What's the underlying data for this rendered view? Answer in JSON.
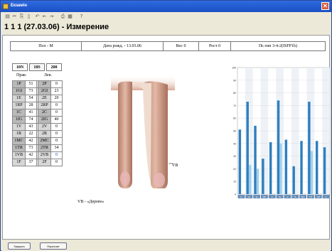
{
  "window": {
    "title": "Екзамін",
    "close_glyph": "✕",
    "heading": "1 1 1 (27.03.06) - Измерение"
  },
  "toolbar": [
    "open-icon",
    "cut-icon",
    "copy-icon",
    "paste-icon",
    "undo-icon",
    "left-arrow-icon",
    "right-arrow-icon",
    "print-icon",
    "chart-icon",
    "help-icon"
  ],
  "toolbar_glyphs": [
    "▤",
    "✂",
    "⎘",
    "▯",
    "↶",
    "←",
    "→",
    "⎙",
    "▦",
    "?"
  ],
  "patient": {
    "sex": "Пол - М",
    "birth": "Дата рожд. - 13.03.06",
    "weight": "Вес 0",
    "height": "Рост 0",
    "psychotype": "Пс.тип 3-4-2(ISFP1b)"
  },
  "frequencies": [
    "10N",
    "10S",
    "200"
  ],
  "selected_frequency": "10S",
  "table_headers": {
    "right": "Прав.",
    "left": "Лев."
  },
  "measurements": [
    {
      "rl": "1P",
      "rv": "51",
      "ll": "2P",
      "lv": "0"
    },
    {
      "rl": "1GI",
      "rv": "73",
      "ll": "2GI",
      "lv": "23"
    },
    {
      "rl": "1E",
      "rv": "54",
      "ll": "2E",
      "lv": "20"
    },
    {
      "rl": "1RP",
      "rv": "28",
      "ll": "2RP",
      "lv": "0"
    },
    {
      "rl": "1C",
      "rv": "41",
      "ll": "2C",
      "lv": "0"
    },
    {
      "rl": "1IG",
      "rv": "74",
      "ll": "2IG",
      "lv": "40"
    },
    {
      "rl": "1V",
      "rv": "43",
      "ll": "2V",
      "lv": "0"
    },
    {
      "rl": "1R",
      "rv": "22",
      "ll": "2R",
      "lv": "0"
    },
    {
      "rl": "1MC",
      "rv": "42",
      "ll": "2MC",
      "lv": "0"
    },
    {
      "rl": "1TR",
      "rv": "73",
      "ll": "2TR",
      "lv": "34"
    },
    {
      "rl": "1VB",
      "rv": "42",
      "ll": "2VB",
      "lv": "0"
    },
    {
      "rl": "1F",
      "rv": "37",
      "ll": "2F",
      "lv": "0"
    }
  ],
  "finger_label": "VB",
  "caption": "VB - «Дерево»",
  "chart_data": {
    "type": "bar",
    "categories": [
      "P",
      "GI",
      "E",
      "RP",
      "C",
      "IG",
      "V",
      "R",
      "MC",
      "TR",
      "VB",
      "F"
    ],
    "series": [
      {
        "values": [
          51,
          73,
          54,
          28,
          41,
          74,
          43,
          22,
          42,
          73,
          42,
          37
        ]
      },
      {
        "values": [
          0,
          23,
          20,
          0,
          0,
          40,
          0,
          0,
          0,
          34,
          0,
          0
        ]
      }
    ],
    "ylim": [
      0,
      100
    ],
    "yticks": [
      "100",
      "90",
      "80",
      "70",
      "60",
      "50",
      "40",
      "30",
      "20",
      "10",
      "0"
    ],
    "colors": [
      "#2f7fc0",
      "#9fd0ef"
    ],
    "grid": true
  },
  "buttons": {
    "close": "Закрыть",
    "recalc": "Пересчет"
  }
}
